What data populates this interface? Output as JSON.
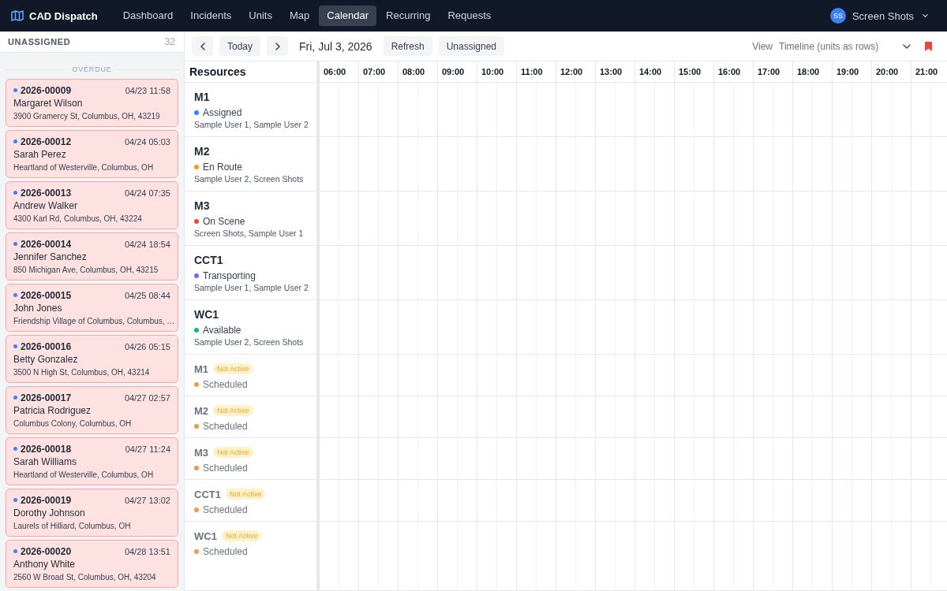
{
  "navbar": {
    "brand": "CAD Dispatch",
    "nav_items": [
      {
        "label": "Dashboard",
        "selected": false
      },
      {
        "label": "Incidents",
        "selected": false
      },
      {
        "label": "Units",
        "selected": false
      },
      {
        "label": "Map",
        "selected": false
      },
      {
        "label": "Calendar",
        "selected": true
      },
      {
        "label": "Recurring",
        "selected": false
      },
      {
        "label": "Requests",
        "selected": false
      }
    ],
    "user": {
      "initials": "SS",
      "name": "Screen Shots"
    }
  },
  "sidebar": {
    "title": "UNASSIGNED",
    "count": "32",
    "section": "OVERDUE",
    "incidents": [
      {
        "number": "2026-00009",
        "time": "04/23 11:58",
        "name": "Margaret Wilson",
        "address": "3900 Gramercy St, Columbus, OH, 43219"
      },
      {
        "number": "2026-00012",
        "time": "04/24 05:03",
        "name": "Sarah Perez",
        "address": "Heartland of Westerville, Columbus, OH"
      },
      {
        "number": "2026-00013",
        "time": "04/24 07:35",
        "name": "Andrew Walker",
        "address": "4300 Karl Rd, Columbus, OH, 43224"
      },
      {
        "number": "2026-00014",
        "time": "04/24 18:54",
        "name": "Jennifer Sanchez",
        "address": "850 Michigan Ave, Columbus, OH, 43215"
      },
      {
        "number": "2026-00015",
        "time": "04/25 08:44",
        "name": "John Jones",
        "address": "Friendship Village of Columbus, Columbus, …"
      },
      {
        "number": "2026-00016",
        "time": "04/26 05:15",
        "name": "Betty Gonzalez",
        "address": "3500 N High St, Columbus, OH, 43214"
      },
      {
        "number": "2026-00017",
        "time": "04/27 02:57",
        "name": "Patricia Rodriguez",
        "address": "Columbus Colony, Columbus, OH"
      },
      {
        "number": "2026-00018",
        "time": "04/27 11:24",
        "name": "Sarah Williams",
        "address": "Heartland of Westerville, Columbus, OH"
      },
      {
        "number": "2026-00019",
        "time": "04/27 13:02",
        "name": "Dorothy Johnson",
        "address": "Laurels of Hilliard, Columbus, OH"
      },
      {
        "number": "2026-00020",
        "time": "04/28 13:51",
        "name": "Anthony White",
        "address": "2560 W Broad St, Columbus, OH, 43204"
      }
    ]
  },
  "toolbar": {
    "today": "Today",
    "date": "Fri, Jul 3, 2026",
    "buttons": [
      "Refresh",
      "Unassigned"
    ],
    "view_label": "View",
    "view_value": "Timeline (units as rows)"
  },
  "timeline": {
    "resources_heading": "Resources",
    "hours": [
      "06:00",
      "07:00",
      "08:00",
      "09:00",
      "10:00",
      "11:00",
      "12:00",
      "13:00",
      "14:00",
      "15:00",
      "16:00",
      "17:00",
      "18:00",
      "19:00",
      "20:00",
      "21:00"
    ],
    "resources": [
      {
        "unit": "M1",
        "active": true,
        "status": "Assigned",
        "color": "#3b82f6",
        "crew": "Sample User 1, Sample User 2"
      },
      {
        "unit": "M2",
        "active": true,
        "status": "En Route",
        "color": "#f59e0b",
        "crew": "Sample User 2, Screen Shots"
      },
      {
        "unit": "M3",
        "active": true,
        "status": "On Scene",
        "color": "#ef4444",
        "crew": "Screen Shots, Sample User 1"
      },
      {
        "unit": "CCT1",
        "active": true,
        "status": "Transporting",
        "color": "#8b5cf6",
        "crew": "Sample User 1, Sample User 2"
      },
      {
        "unit": "WC1",
        "active": true,
        "status": "Available",
        "color": "#10b981",
        "crew": "Sample User 2, Screen Shots"
      },
      {
        "unit": "M1",
        "active": false,
        "badge": "Not Active",
        "status": "Scheduled",
        "color": "#ed9a4b"
      },
      {
        "unit": "M2",
        "active": false,
        "badge": "Not Active",
        "status": "Scheduled",
        "color": "#ed9a4b"
      },
      {
        "unit": "M3",
        "active": false,
        "badge": "Not Active",
        "status": "Scheduled",
        "color": "#ed9a4b"
      },
      {
        "unit": "CCT1",
        "active": false,
        "badge": "Not Active",
        "status": "Scheduled",
        "color": "#ed9a4b"
      },
      {
        "unit": "WC1",
        "active": false,
        "badge": "Not Active",
        "status": "Scheduled",
        "color": "#ed9a4b"
      }
    ]
  }
}
